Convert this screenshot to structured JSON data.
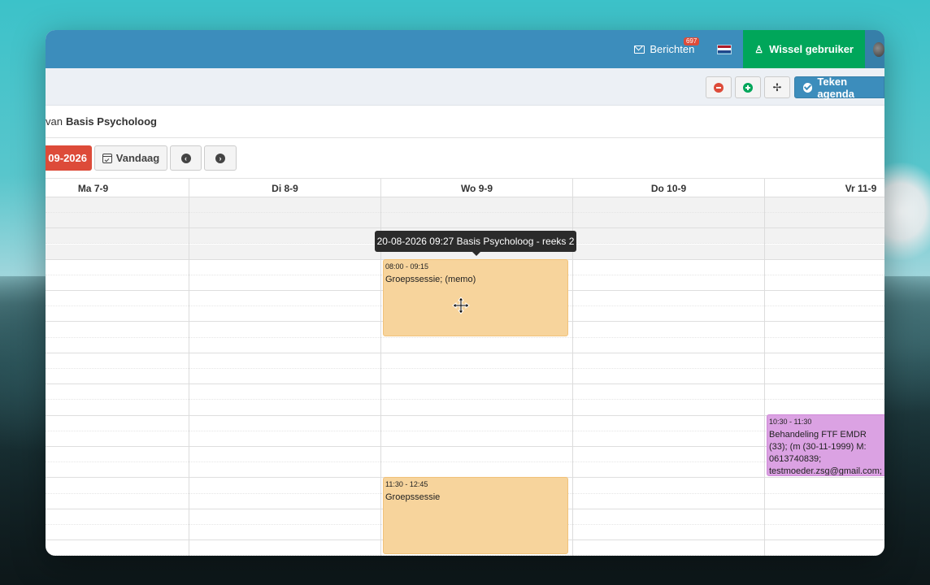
{
  "topbar": {
    "messages_label": "Berichten",
    "messages_badge": "697",
    "switch_user_label": "Wissel gebruiker"
  },
  "toolbar": {
    "draw_agenda_label": "Teken agenda"
  },
  "subtitle": {
    "prefix": "van",
    "name": "Basis Psycholoog"
  },
  "nav": {
    "date_label": "09-2026",
    "today_label": "Vandaag"
  },
  "days": [
    "Ma 7-9",
    "Di 8-9",
    "Wo 9-9",
    "Do 10-9",
    "Vr 11-9"
  ],
  "tooltip": "20-08-2026 09:27 Basis Psycholoog - reeks 2",
  "events": [
    {
      "time": "08:00 - 09:15",
      "title": "Groepssessie; (memo)"
    },
    {
      "time": "11:30 - 12:45",
      "title": "Groepssessie"
    },
    {
      "time": "10:30 - 11:30",
      "title": "Behandeling FTF EMDR (33); (m (30-11-1999) M: 0613740839; testmoeder.zsg@gmail.com; (A balk)"
    }
  ],
  "colors": {
    "topbar": "#3c8dbc",
    "switch_user": "#00a65a",
    "date_button": "#dd4b39",
    "event_orange": "#f7d49c",
    "event_purple": "#dba2e3"
  }
}
